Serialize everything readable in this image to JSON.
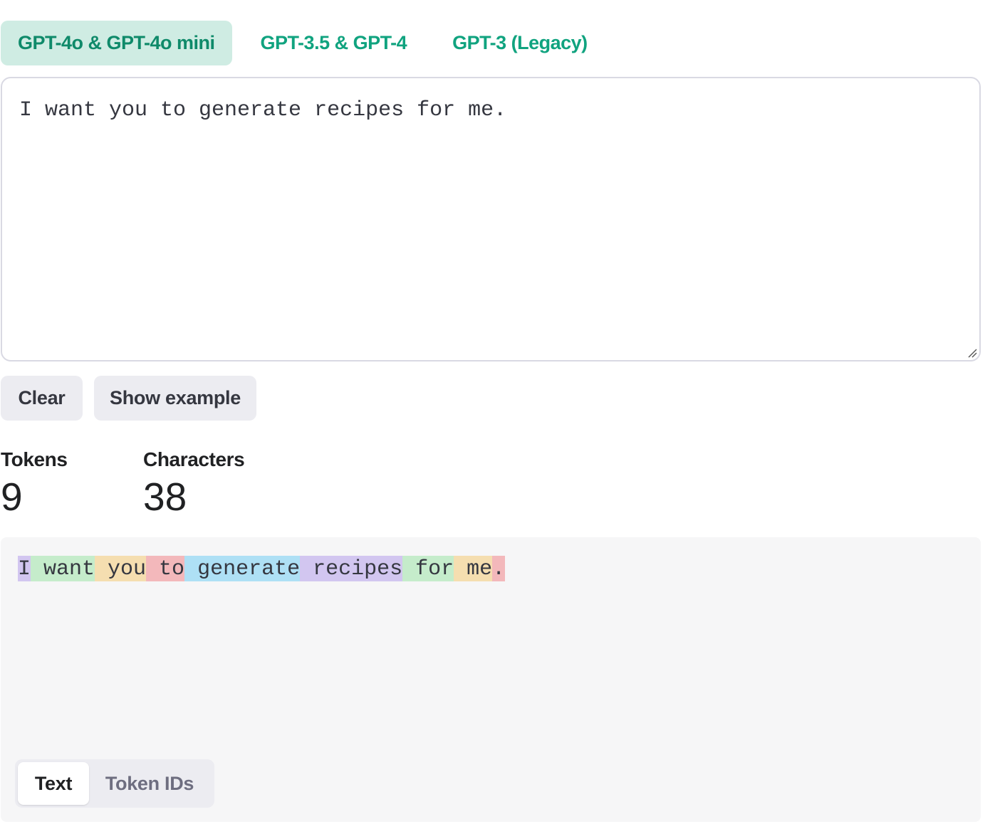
{
  "model_tabs": [
    {
      "label": "GPT-4o & GPT-4o mini",
      "active": true
    },
    {
      "label": "GPT-3.5 & GPT-4",
      "active": false
    },
    {
      "label": "GPT-3 (Legacy)",
      "active": false
    }
  ],
  "input": {
    "value": "I want you to generate recipes for me."
  },
  "buttons": {
    "clear_label": "Clear",
    "example_label": "Show example"
  },
  "stats": {
    "tokens_label": "Tokens",
    "tokens_value": "9",
    "characters_label": "Characters",
    "characters_value": "38"
  },
  "tokens": [
    {
      "text": "I",
      "color": "#d2c6f0"
    },
    {
      "text": " want",
      "color": "#c5eccb"
    },
    {
      "text": " you",
      "color": "#f5deb0"
    },
    {
      "text": " to",
      "color": "#f3b8bb"
    },
    {
      "text": " generate",
      "color": "#aee0f5"
    },
    {
      "text": " recipes",
      "color": "#d2c6f0"
    },
    {
      "text": " for",
      "color": "#c5eccb"
    },
    {
      "text": " me",
      "color": "#f5deb0"
    },
    {
      "text": ".",
      "color": "#f3b8bb"
    }
  ],
  "view_toggle": {
    "text_label": "Text",
    "token_ids_label": "Token IDs"
  },
  "colors": {
    "accent": "#10a37f",
    "active_tab_bg": "#cfece3",
    "button_bg": "#ececf1",
    "output_bg": "#f6f6f7"
  }
}
